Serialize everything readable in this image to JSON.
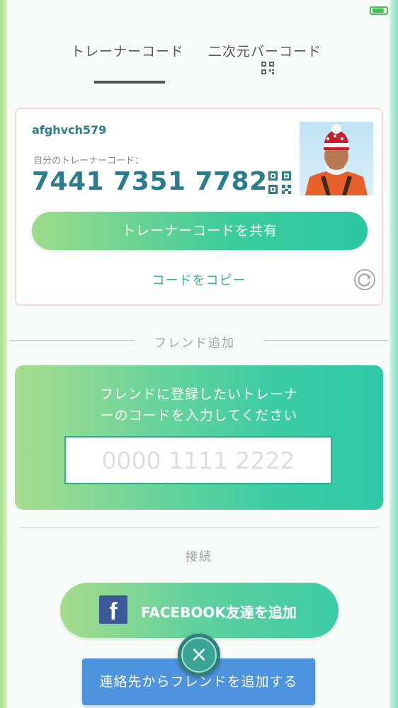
{
  "tabs": {
    "trainer_code": "トレーナーコード",
    "qr_code": "二次元バーコード"
  },
  "profile": {
    "username": "afghvch579",
    "code_label": "自分のトレーナーコード：",
    "code": "7441 7351 7782",
    "share_label": "トレーナーコードを共有",
    "copy_label": "コードをコピー"
  },
  "add_friend": {
    "section_label": "フレンド追加",
    "title_line1": "フレンドに登録したいトレーナ",
    "title_line2": "ーのコードを入力してください",
    "input_placeholder": "0000 1111 2222",
    "input_value": ""
  },
  "connect": {
    "section_label": "接続",
    "facebook_label": "FACEBOOK友達を追加",
    "contacts_label": "連絡先からフレンドを追加する"
  },
  "icons": {
    "qr": "qr-code-icon",
    "refresh": "refresh-icon",
    "facebook": "facebook-icon",
    "close": "close-icon",
    "battery": "battery-icon"
  },
  "colors": {
    "accent_teal": "#2a7d8c",
    "button_green_start": "#9fdb8a",
    "button_green_end": "#2bc7a3",
    "contacts_blue": "#4d93de",
    "facebook_blue": "#3b5998"
  }
}
